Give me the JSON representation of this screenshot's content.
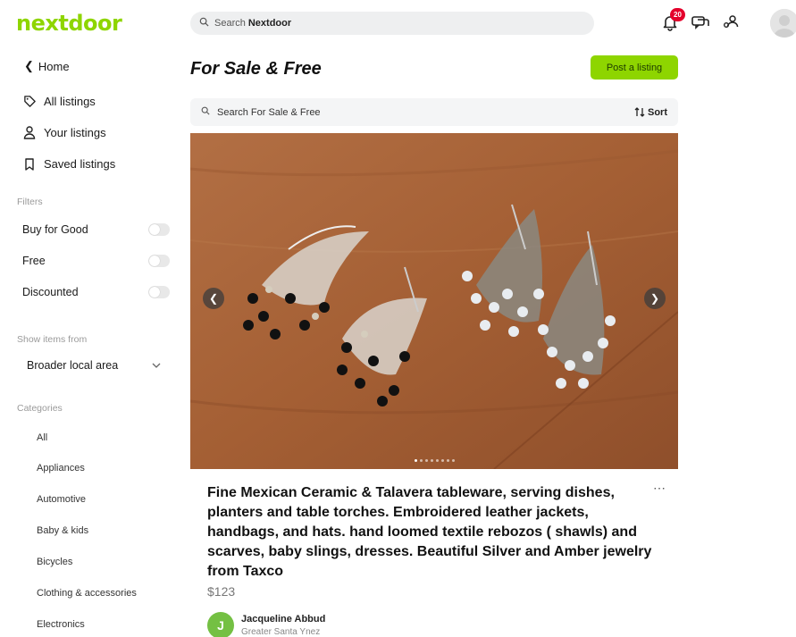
{
  "brand": {
    "logo_text": "nextdoor",
    "accent": "#8ed500"
  },
  "top_search": {
    "prefix": "Search",
    "brand": "Nextdoor"
  },
  "notifications": {
    "count": "20"
  },
  "sidebar": {
    "home": "Home",
    "nav": [
      {
        "label": "All listings",
        "icon": "tag-icon"
      },
      {
        "label": "Your listings",
        "icon": "person-icon"
      },
      {
        "label": "Saved listings",
        "icon": "bookmark-icon"
      }
    ],
    "filters_label": "Filters",
    "filters": [
      {
        "label": "Buy for Good",
        "on": false
      },
      {
        "label": "Free",
        "on": false
      },
      {
        "label": "Discounted",
        "on": false
      }
    ],
    "show_items_label": "Show items from",
    "area_value": "Broader local area",
    "categories_label": "Categories",
    "categories": [
      "All",
      "Appliances",
      "Automotive",
      "Baby & kids",
      "Bicycles",
      "Clothing & accessories",
      "Electronics"
    ]
  },
  "main": {
    "title": "For Sale & Free",
    "post_button": "Post a listing",
    "search_placeholder": "Search For Sale & Free",
    "sort_label": "Sort"
  },
  "listing": {
    "title": "Fine Mexican Ceramic & Talavera tableware, serving dishes, planters and table torches. Embroidered leather jackets, handbags, and hats. hand loomed textile rebozos ( shawls) and scarves, baby slings, dresses. Beautiful Silver and Amber jewelry from Taxco",
    "price": "$123",
    "seller_initial": "J",
    "seller_name": "Jacqueline Abbud",
    "seller_location": "Greater Santa Ynez",
    "photo_count": 8,
    "photo_index": 1
  }
}
